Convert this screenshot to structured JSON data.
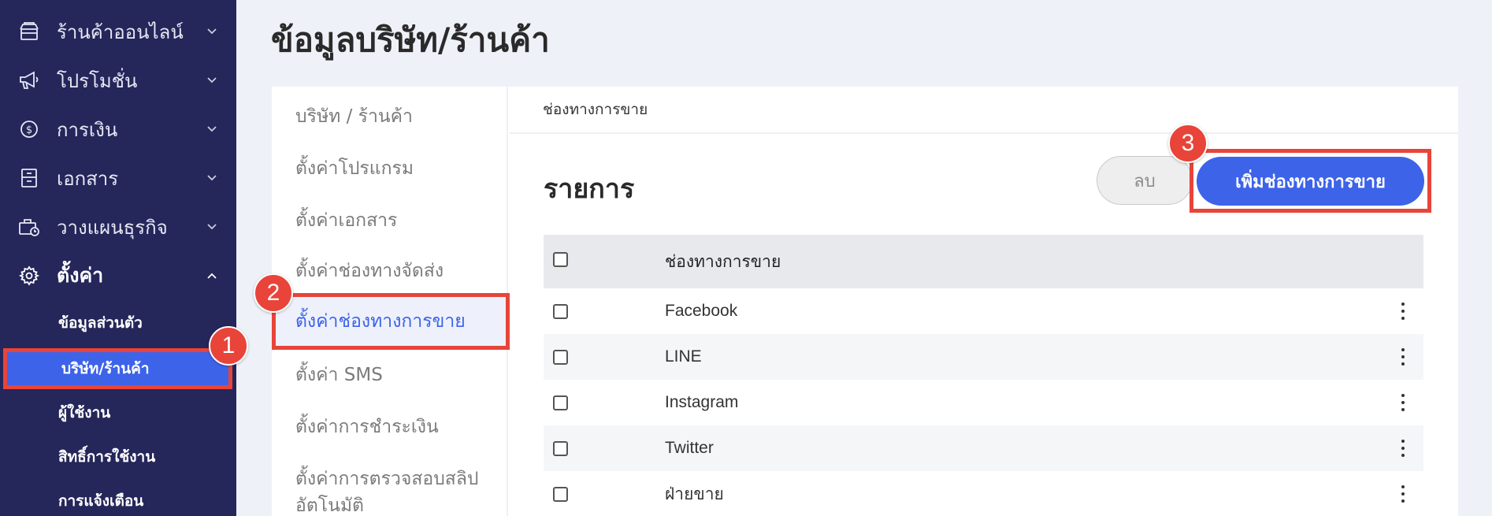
{
  "sidebar": {
    "items": [
      {
        "label": "ร้านค้าออนไลน์",
        "icon": "store-icon"
      },
      {
        "label": "โปรโมชั่น",
        "icon": "megaphone-icon"
      },
      {
        "label": "การเงิน",
        "icon": "dollar-icon"
      },
      {
        "label": "เอกสาร",
        "icon": "document-icon"
      },
      {
        "label": "วางแผนธุรกิจ",
        "icon": "briefcase-icon"
      },
      {
        "label": "ตั้งค่า",
        "icon": "gear-icon"
      }
    ],
    "sub_items": [
      {
        "label": "ข้อมูลส่วนตัว"
      },
      {
        "label": "บริษัท/ร้านค้า"
      },
      {
        "label": "ผู้ใช้งาน"
      },
      {
        "label": "สิทธิ์การใช้งาน"
      },
      {
        "label": "การแจ้งเตือน"
      }
    ]
  },
  "page": {
    "title": "ข้อมูลบริษัท/ร้านค้า"
  },
  "settings_menu": {
    "items": [
      {
        "label": "บริษัท / ร้านค้า"
      },
      {
        "label": "ตั้งค่าโปรแกรม"
      },
      {
        "label": "ตั้งค่าเอกสาร"
      },
      {
        "label": "ตั้งค่าช่องทางจัดส่ง"
      },
      {
        "label": "ตั้งค่าช่องทางการขาย"
      },
      {
        "label": "ตั้งค่า SMS"
      },
      {
        "label": "ตั้งค่าการชำระเงิน"
      },
      {
        "label": "ตั้งค่าการตรวจสอบสลิป"
      },
      {
        "label": "อัตโนมัติ"
      }
    ]
  },
  "content": {
    "header": "ช่องทางการขาย",
    "section_title": "รายการ",
    "delete_label": "ลบ",
    "add_label": "เพิ่มช่องทางการขาย",
    "table": {
      "column": "ช่องทางการขาย",
      "rows": [
        "Facebook",
        "LINE",
        "Instagram",
        "Twitter",
        "ฝ่ายขาย"
      ]
    }
  },
  "annotations": {
    "step1": "1",
    "step2": "2",
    "step3": "3"
  },
  "colors": {
    "sidebar_bg": "#25265a",
    "accent_blue": "#3d63e9",
    "highlight_red": "#e8443a"
  }
}
